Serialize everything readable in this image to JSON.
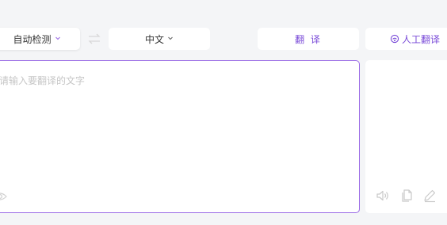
{
  "toolbar": {
    "source_lang": "自动检测",
    "target_lang": "中文",
    "translate_label": "翻 译",
    "human_translate_label": "人工翻译"
  },
  "source": {
    "placeholder": "请输入要翻译的文字",
    "value": ""
  },
  "colors": {
    "accent": "#7a4bd8",
    "border_active": "#9a6ae6",
    "background": "#f4f5f7",
    "icon_gray": "#c9c9c9"
  },
  "icons": {
    "source_dropdown": "chevron-down-icon",
    "target_dropdown": "chevron-down-icon",
    "swap": "swap-arrows-icon",
    "human": "human-translate-icon",
    "eye": "eye-icon",
    "speaker": "speaker-icon",
    "copy": "copy-icon",
    "edit": "edit-pencil-icon"
  }
}
